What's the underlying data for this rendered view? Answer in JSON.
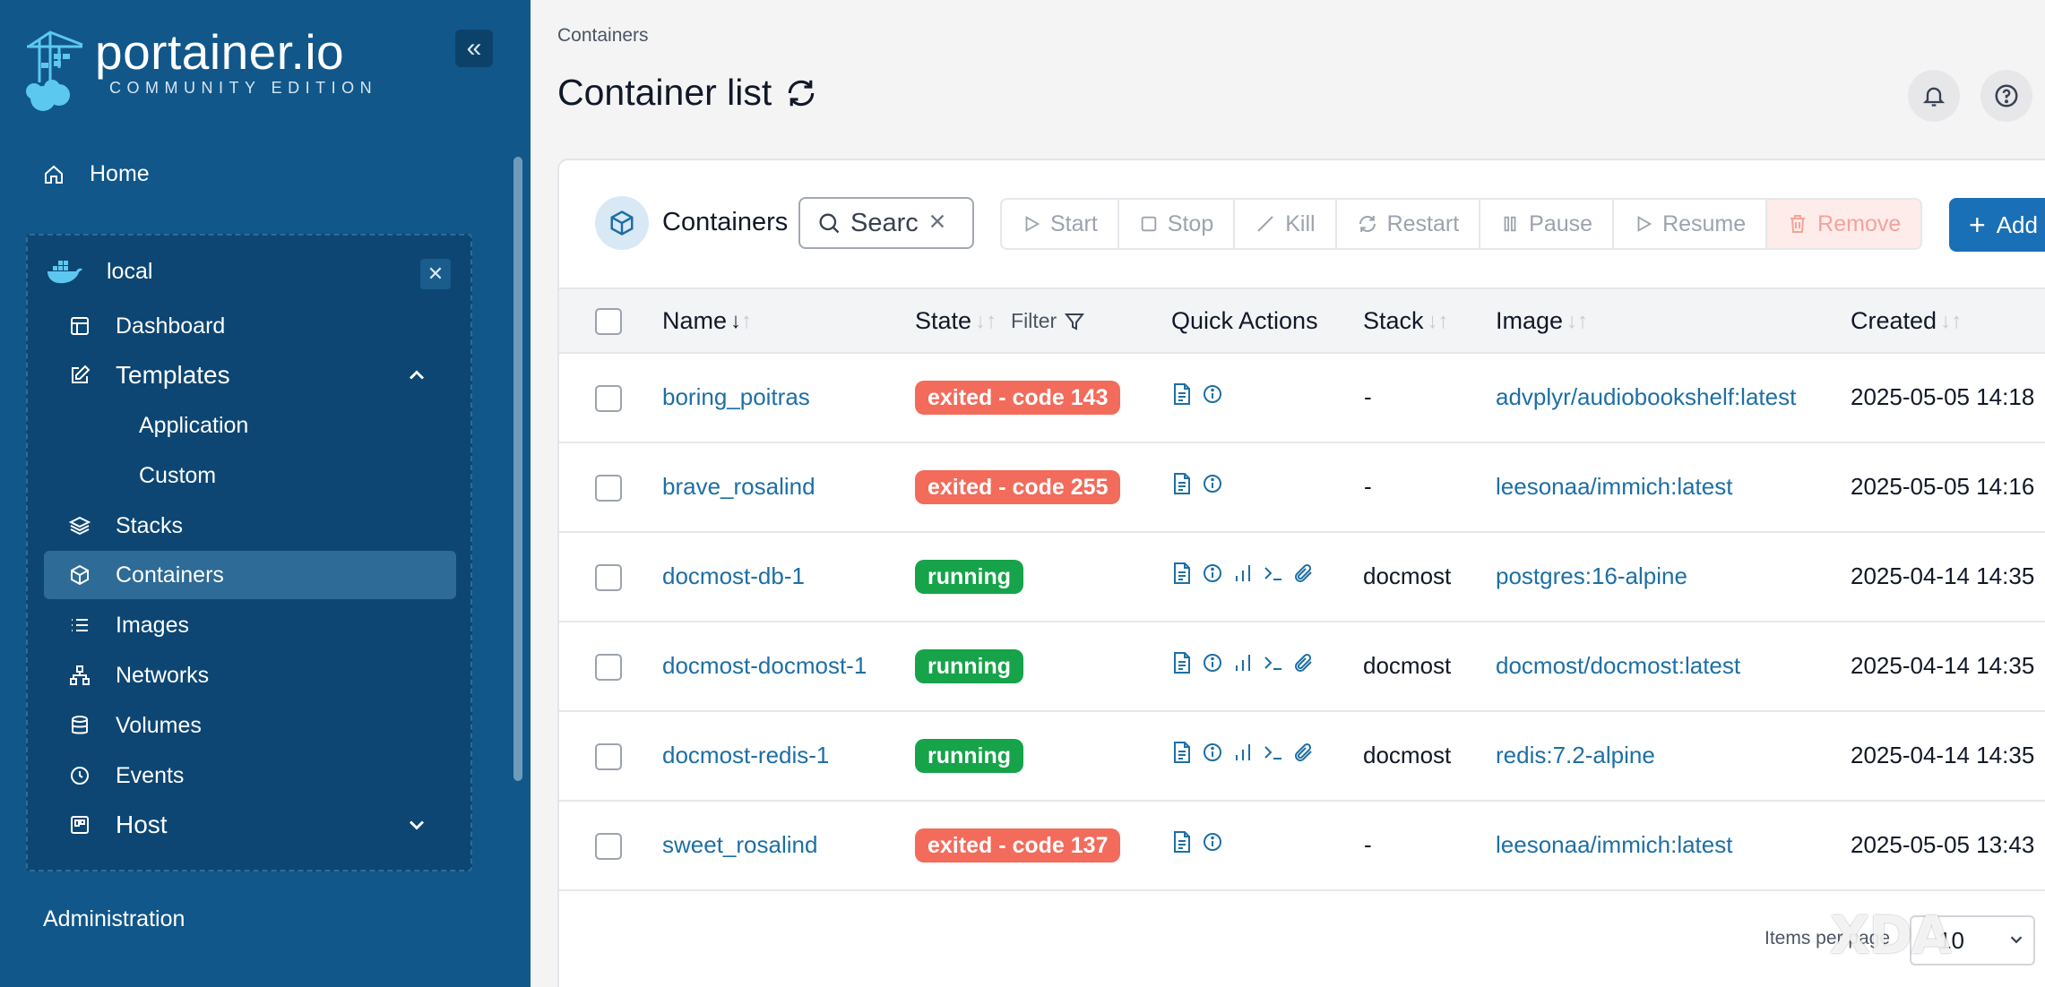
{
  "brand": {
    "name": "portainer.io",
    "edition": "COMMUNITY EDITION"
  },
  "sidebar": {
    "home": "Home",
    "environment": "local",
    "items": [
      {
        "label": "Dashboard",
        "icon": "dashboard-icon"
      },
      {
        "label": "Templates",
        "icon": "edit-icon",
        "expanded": true
      },
      {
        "label": "Application",
        "sub": true
      },
      {
        "label": "Custom",
        "sub": true
      },
      {
        "label": "Stacks",
        "icon": "layers-icon"
      },
      {
        "label": "Containers",
        "icon": "cube-icon",
        "active": true
      },
      {
        "label": "Images",
        "icon": "list-icon"
      },
      {
        "label": "Networks",
        "icon": "network-icon"
      },
      {
        "label": "Volumes",
        "icon": "database-icon"
      },
      {
        "label": "Events",
        "icon": "clock-icon"
      },
      {
        "label": "Host",
        "icon": "host-icon",
        "expanded": false
      }
    ],
    "administration": "Administration"
  },
  "header": {
    "breadcrumb": "Containers",
    "title": "Container list"
  },
  "toolbar": {
    "title": "Containers",
    "search_value": "Searc",
    "buttons": {
      "start": "Start",
      "stop": "Stop",
      "kill": "Kill",
      "restart": "Restart",
      "pause": "Pause",
      "resume": "Resume",
      "remove": "Remove"
    },
    "add": "Add"
  },
  "table": {
    "columns": {
      "name": "Name",
      "state": "State",
      "filter": "Filter",
      "quick_actions": "Quick Actions",
      "stack": "Stack",
      "image": "Image",
      "created": "Created"
    },
    "rows": [
      {
        "name": "boring_poitras",
        "state": "exited - code 143",
        "status": "exited",
        "actions": 2,
        "stack": "-",
        "image": "advplyr/audiobookshelf:latest",
        "created": "2025-05-05 14:18"
      },
      {
        "name": "brave_rosalind",
        "state": "exited - code 255",
        "status": "exited",
        "actions": 2,
        "stack": "-",
        "image": "leesonaa/immich:latest",
        "created": "2025-05-05 14:16"
      },
      {
        "name": "docmost-db-1",
        "state": "running",
        "status": "running",
        "actions": 5,
        "stack": "docmost",
        "image": "postgres:16-alpine",
        "created": "2025-04-14 14:35"
      },
      {
        "name": "docmost-docmost-1",
        "state": "running",
        "status": "running",
        "actions": 5,
        "stack": "docmost",
        "image": "docmost/docmost:latest",
        "created": "2025-04-14 14:35"
      },
      {
        "name": "docmost-redis-1",
        "state": "running",
        "status": "running",
        "actions": 5,
        "stack": "docmost",
        "image": "redis:7.2-alpine",
        "created": "2025-04-14 14:35"
      },
      {
        "name": "sweet_rosalind",
        "state": "exited - code 137",
        "status": "exited",
        "actions": 2,
        "stack": "-",
        "image": "leesonaa/immich:latest",
        "created": "2025-05-05 13:43"
      }
    ]
  },
  "pagination": {
    "label": "Items per page",
    "value": "10"
  },
  "watermark": "XDA",
  "colors": {
    "sidebar": "#11578a",
    "exited": "#f26b5b",
    "running": "#16a34a",
    "link": "#1d6fa5",
    "primary": "#1a70b7"
  }
}
